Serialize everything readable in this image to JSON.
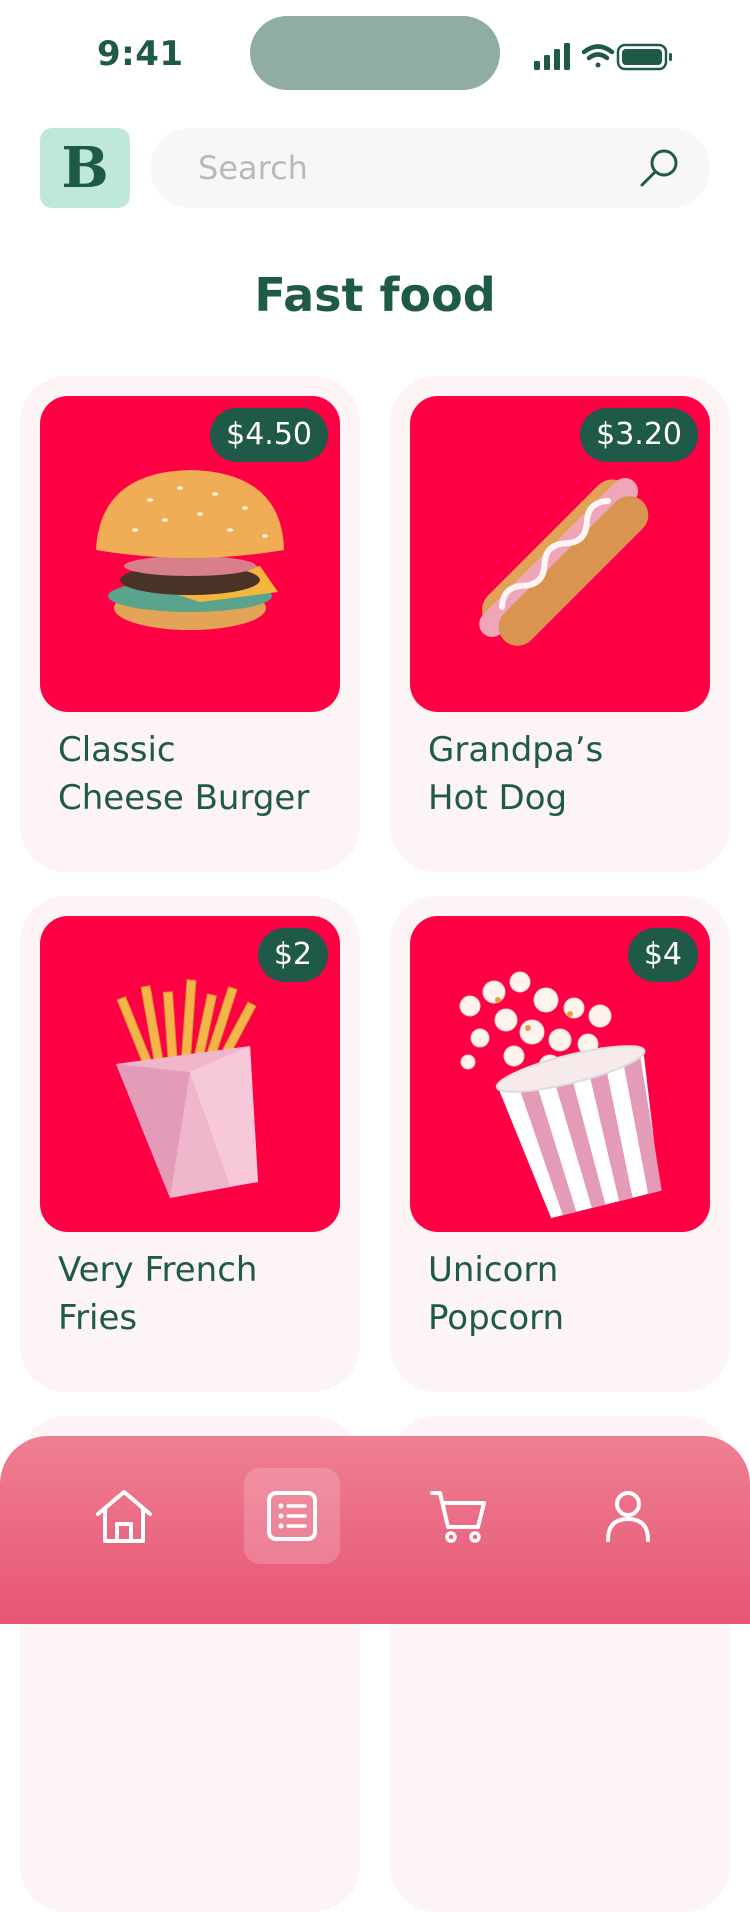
{
  "status_bar": {
    "time": "9:41"
  },
  "header": {
    "logo_letter": "B",
    "search": {
      "placeholder": "Search",
      "value": ""
    }
  },
  "page": {
    "title": "Fast food"
  },
  "products": [
    {
      "name_line1": "Classic",
      "name_line2": "Cheese Burger",
      "price": "$4.50",
      "image_icon": "burger-image"
    },
    {
      "name_line1": "Grandpa’s",
      "name_line2": "Hot Dog",
      "price": "$3.20",
      "image_icon": "hot-dog-image"
    },
    {
      "name_line1": "Very French",
      "name_line2": "Fries",
      "price": "$2",
      "image_icon": "fries-image"
    },
    {
      "name_line1": "Unicorn",
      "name_line2": "Popcorn",
      "price": "$4",
      "image_icon": "popcorn-image"
    }
  ],
  "bottom_nav": {
    "items": [
      {
        "icon": "home-icon",
        "active": false
      },
      {
        "icon": "list-icon",
        "active": true
      },
      {
        "icon": "cart-icon",
        "active": false
      },
      {
        "icon": "user-icon",
        "active": false
      }
    ]
  },
  "colors": {
    "brand_green": "#1f5a48",
    "logo_bg": "#bfe8d8",
    "card_image_bg": "#ff0044",
    "card_bg": "#fcf4f5",
    "nav_gradient_top": "#ee8092",
    "nav_gradient_bottom": "#e75574"
  }
}
